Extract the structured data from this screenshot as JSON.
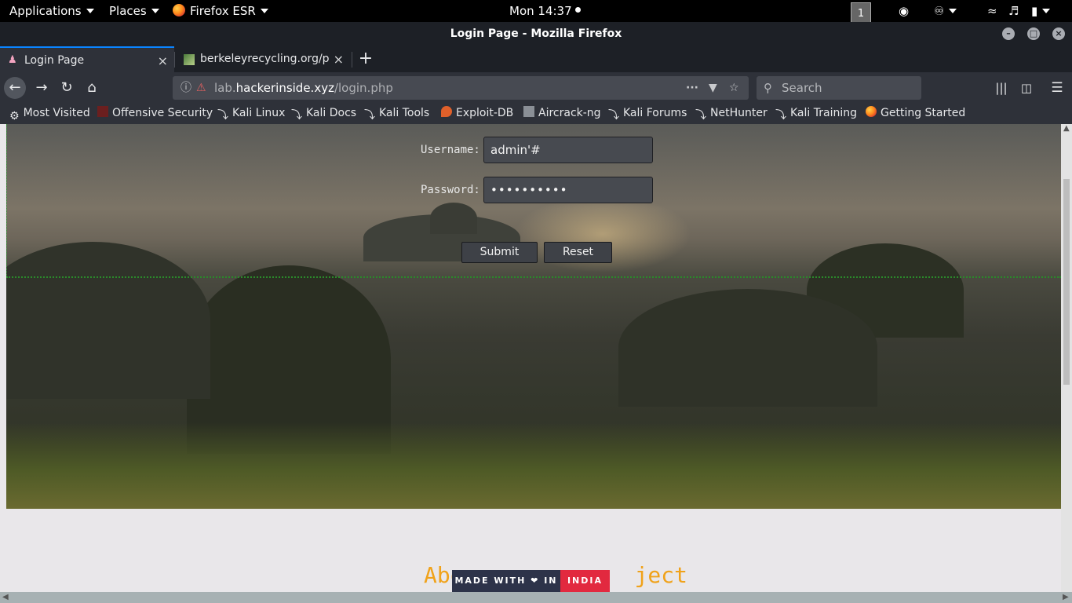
{
  "system_bar": {
    "applications": "Applications",
    "places": "Places",
    "firefox": "Firefox ESR",
    "clock": "Mon 14:37",
    "workspace": "1"
  },
  "window": {
    "title": "Login Page - Mozilla Firefox"
  },
  "tabs": [
    {
      "label": "Login Page"
    },
    {
      "label": "berkeleyrecycling.org/pa"
    }
  ],
  "navbar": {
    "url_prefix": "lab.",
    "url_host": "hackerinside.xyz",
    "url_path": "/login.php",
    "search_placeholder": "Search"
  },
  "bookmarks": [
    "Most Visited",
    "Offensive Security",
    "Kali Linux",
    "Kali Docs",
    "Kali Tools",
    "Exploit-DB",
    "Aircrack-ng",
    "Kali Forums",
    "NetHunter",
    "Kali Training",
    "Getting Started"
  ],
  "form": {
    "username_label": "Username:",
    "username_value": "admin'#",
    "password_label": "Password:",
    "password_value": "••••••••••",
    "submit_label": "Submit",
    "reset_label": "Reset"
  },
  "footer": {
    "heading_left": "Abo",
    "heading_right": "ject",
    "badge_left": "MADE WITH ❤ IN",
    "badge_right": "INDIA"
  },
  "colors": {
    "accent_blue": "#0a84ff",
    "heading_orange": "#f0a21a",
    "badge_navy": "#2d3349",
    "badge_red": "#e2293f"
  }
}
